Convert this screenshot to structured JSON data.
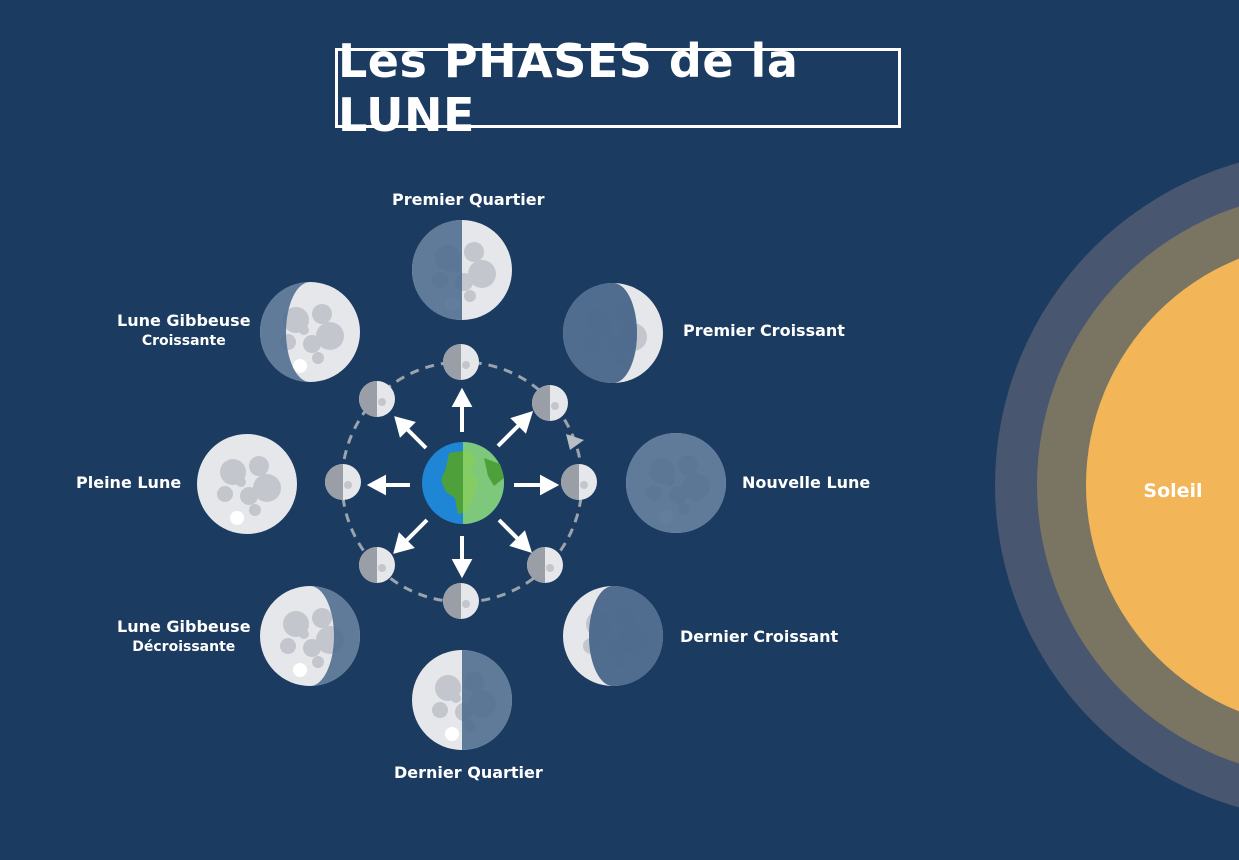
{
  "title": "Les PHASES de la LUNE",
  "sun_label": "Soleil",
  "phases": [
    {
      "id": "premier-quartier",
      "line1": "Premier Quartier",
      "line2": ""
    },
    {
      "id": "premier-croissant",
      "line1": "Premier Croissant",
      "line2": ""
    },
    {
      "id": "nouvelle-lune",
      "line1": "Nouvelle Lune",
      "line2": ""
    },
    {
      "id": "dernier-croissant",
      "line1": "Dernier Croissant",
      "line2": ""
    },
    {
      "id": "dernier-quartier",
      "line1": "Dernier Quartier",
      "line2": ""
    },
    {
      "id": "gibbeuse-decroissante",
      "line1": "Lune Gibbeuse",
      "line2": "Décroissante"
    },
    {
      "id": "pleine-lune",
      "line1": "Pleine Lune",
      "line2": ""
    },
    {
      "id": "gibbeuse-croissante",
      "line1": "Lune Gibbeuse",
      "line2": "Croissante"
    }
  ],
  "colors": {
    "background": "#1b3b61",
    "moon_light": "#e6e7ea",
    "moon_dark": "#4d6b8e",
    "sun": "#f2b557",
    "sun_glow_inner": "#7a7563",
    "sun_glow_outer": "#48566f",
    "earth_ocean": "#1f86d6",
    "earth_land": "#8fd36b"
  }
}
